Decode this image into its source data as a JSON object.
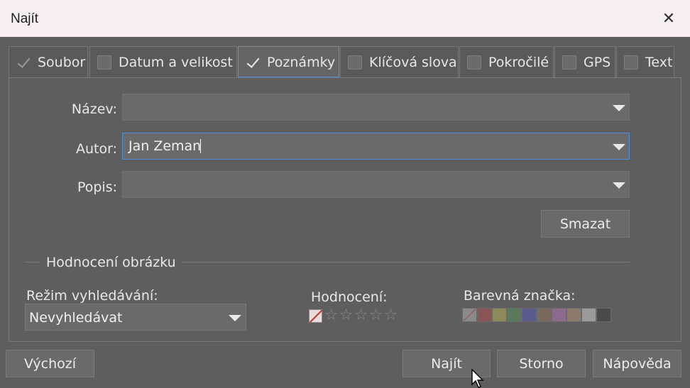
{
  "window": {
    "title": "Najít"
  },
  "tabs": [
    {
      "label": "Soubor",
      "checked": true
    },
    {
      "label": "Datum a velikost",
      "checked": false
    },
    {
      "label": "Poznámky",
      "checked": true
    },
    {
      "label": "Klíčová slova",
      "checked": false
    },
    {
      "label": "Pokročilé",
      "checked": false
    },
    {
      "label": "GPS",
      "checked": false
    },
    {
      "label": "Text",
      "checked": false
    }
  ],
  "form": {
    "name_label": "Název:",
    "name_value": "",
    "author_label": "Autor:",
    "author_value": "Jan Zeman",
    "description_label": "Popis:",
    "description_value": "",
    "clear_button": "Smazat"
  },
  "rating": {
    "section_title": "Hodnocení obrázku",
    "mode_label": "Režim vyhledávání:",
    "mode_value": "Nevyhledávat",
    "rating_label": "Hodnocení:",
    "color_label": "Barevná značka:",
    "colors": [
      "#8a8a8a",
      "#8a5454",
      "#8c8a58",
      "#5b7a5b",
      "#5a5a8c",
      "#7a6a5e",
      "#8c6a8c",
      "#8c7a6a",
      "#9a9a9a",
      "#4a4a4a"
    ]
  },
  "buttons": {
    "default": "Výchozí",
    "find": "Najít",
    "cancel": "Storno",
    "help": "Nápověda"
  }
}
